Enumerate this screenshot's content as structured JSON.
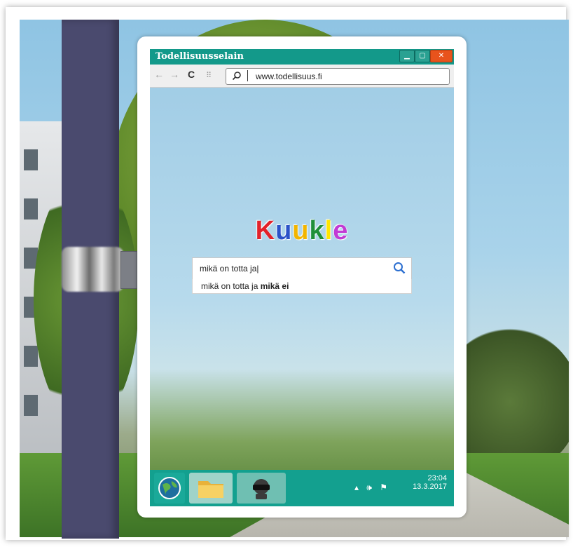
{
  "browser": {
    "title": "Todellisuusselain",
    "url": "www.todellisuus.fi",
    "back_icon": "arrow-left-icon",
    "forward_icon": "arrow-right-icon",
    "reload_icon": "reload-icon",
    "apps_icon": "grid-icon",
    "search_icon": "search-icon"
  },
  "search_page": {
    "logo_letters": [
      "K",
      "u",
      "u",
      "k",
      "l",
      "e"
    ],
    "logo_colors": [
      "#e2222a",
      "#2a52c8",
      "#f2b500",
      "#1f8f3a",
      "#ffe600",
      "#c23bd4"
    ],
    "query": "mikä on totta ja|",
    "suggestion_prefix": "mikä on totta ja ",
    "suggestion_bold": "mikä ei"
  },
  "taskbar": {
    "time": "23:04",
    "date": "13.3.2017",
    "tray_icons": [
      "chevron-up-icon",
      "speaker-icon",
      "flag-icon"
    ],
    "apps": [
      "globe-icon",
      "folder-icon",
      "vr-headset-icon"
    ]
  },
  "colors": {
    "accent": "#13998a",
    "pole": "#4a4a6e"
  }
}
